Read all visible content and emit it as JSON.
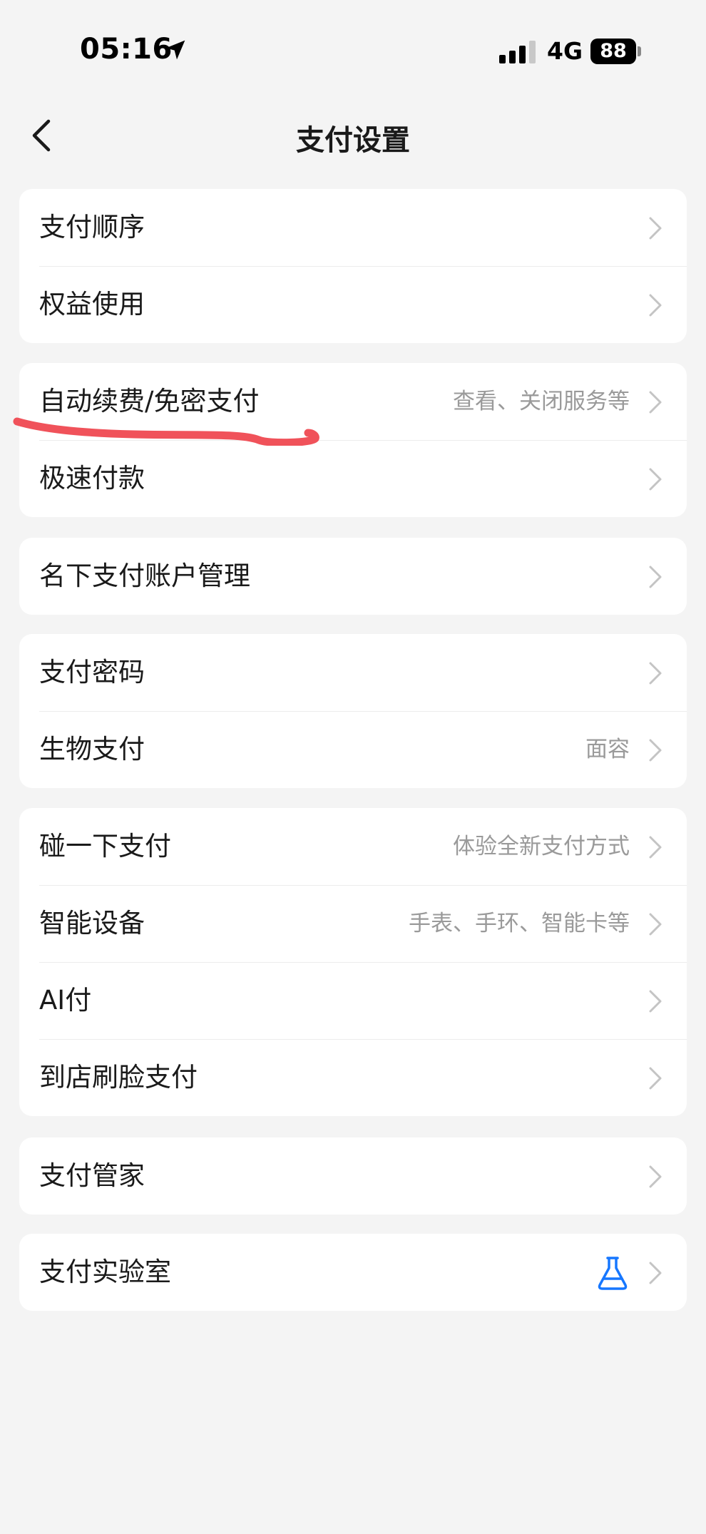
{
  "status_bar": {
    "time": "05:16",
    "network": "4G",
    "battery": "88"
  },
  "nav": {
    "title": "支付设置"
  },
  "groups": [
    {
      "items": [
        {
          "label": "支付顺序",
          "value": ""
        },
        {
          "label": "权益使用",
          "value": ""
        }
      ]
    },
    {
      "items": [
        {
          "label": "自动续费/免密支付",
          "value": "查看、关闭服务等"
        },
        {
          "label": "极速付款",
          "value": ""
        }
      ]
    },
    {
      "items": [
        {
          "label": "名下支付账户管理",
          "value": ""
        }
      ]
    },
    {
      "items": [
        {
          "label": "支付密码",
          "value": ""
        },
        {
          "label": "生物支付",
          "value": "面容"
        }
      ]
    },
    {
      "items": [
        {
          "label": "碰一下支付",
          "value": "体验全新支付方式"
        },
        {
          "label": "智能设备",
          "value": "手表、手环、智能卡等"
        },
        {
          "label": "AI付",
          "value": ""
        },
        {
          "label": "到店刷脸支付",
          "value": ""
        }
      ]
    },
    {
      "items": [
        {
          "label": "支付管家",
          "value": ""
        }
      ]
    },
    {
      "items": [
        {
          "label": "支付实验室",
          "value": "",
          "icon": "flask-icon"
        }
      ]
    }
  ],
  "colors": {
    "background": "#f4f4f4",
    "card": "#ffffff",
    "accent_icon": "#1677ff",
    "annotation": "#f0525a"
  }
}
